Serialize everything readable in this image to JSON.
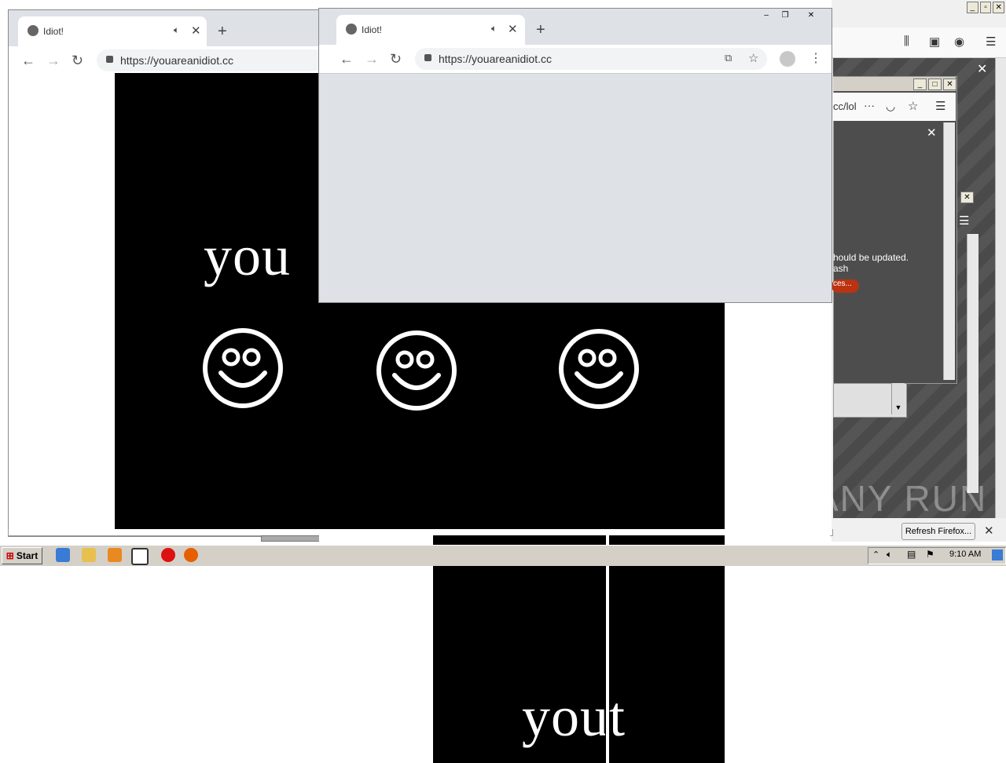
{
  "firefox_bg": {
    "url_fragment": "cc/lol",
    "warning_line1": "hould be updated.",
    "warning_line2": "ash",
    "warning_button": "ces...",
    "refresh_label": "Refresh Firefox...",
    "watermark": "ANY RUN"
  },
  "chrome_back": {
    "tab_title": "Idiot!",
    "url": "https://youareanidiot.cc",
    "text": "you"
  },
  "chrome_front": {
    "tab_title": "Idiot!",
    "url": "https://youareanidiot.cc",
    "text": "yout"
  },
  "taskbar": {
    "start_label": "Start",
    "clock": "9:10 AM"
  },
  "colors": {
    "page_black": "#000000",
    "chrome_frame": "#dee1e6",
    "taskbar": "#d4d0c8",
    "ff_warning_btn": "#bb3311"
  }
}
